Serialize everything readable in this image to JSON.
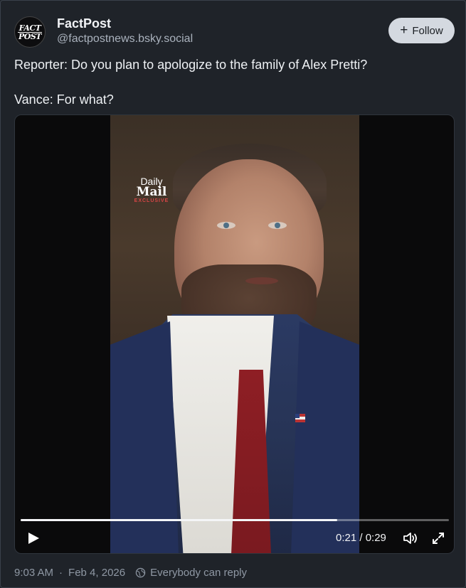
{
  "author": {
    "name": "FactPost",
    "handle": "@factpostnews.bsky.social",
    "avatar_line1": "FACT",
    "avatar_line2": "POST"
  },
  "follow_button": {
    "icon": "plus-icon",
    "label": "Follow"
  },
  "post": {
    "line1": "Reporter: Do you plan to apologize to the family of Alex Pretti?",
    "line2": "Vance: For what?"
  },
  "video": {
    "watermark_line1": "Daily",
    "watermark_line2": "Mail",
    "watermark_line3": "EXCLUSIVE",
    "progress_fraction": 0.74,
    "time_display": "0:21 / 0:29",
    "play_icon": "play-icon",
    "volume_icon": "volume-icon",
    "fullscreen_icon": "fullscreen-icon"
  },
  "footer": {
    "timestamp": "9:03 AM",
    "separator": "·",
    "date": "Feb 4, 2026",
    "reply_icon": "globe-icon",
    "reply_setting": "Everybody can reply"
  },
  "colors": {
    "background": "#1f2329",
    "follow_bg": "#d4d9e0",
    "muted_text": "#8f98a4"
  }
}
